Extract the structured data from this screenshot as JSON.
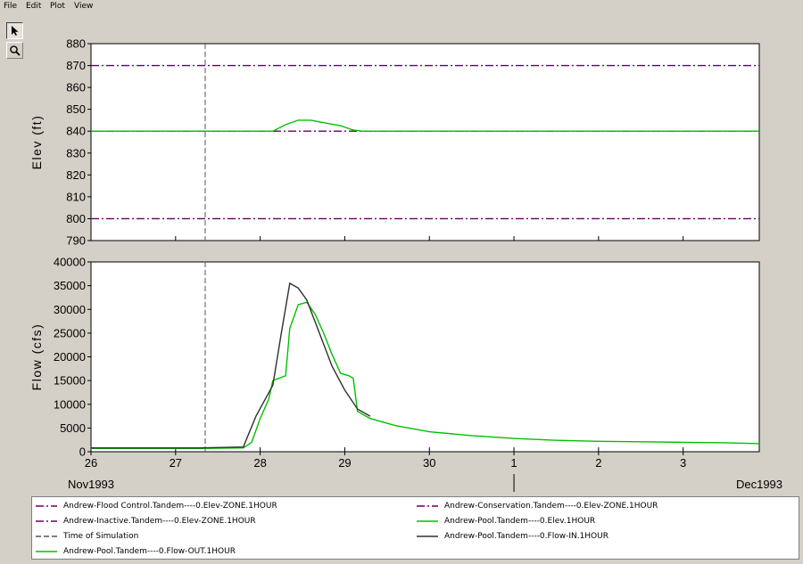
{
  "menu": [
    "File",
    "Edit",
    "Plot",
    "View"
  ],
  "toolbar": {
    "pointer_icon": "arrow-pointer-icon",
    "zoom_icon": "magnifier-icon"
  },
  "colors": {
    "guide": "#660066",
    "pool": "#00c000",
    "inflow": "#303030",
    "sim_time": "#555555"
  },
  "chart_data": [
    {
      "type": "line",
      "ylabel": "Elev (ft)",
      "ylim": [
        790,
        880
      ],
      "yticks": [
        790,
        800,
        810,
        820,
        830,
        840,
        850,
        860,
        870,
        880
      ],
      "xlim": [
        26,
        33.9
      ],
      "grid": false,
      "series": [
        {
          "name": "Andrew-Flood Control.Tandem----0.Elev-ZONE.1HOUR",
          "style": "dashdot",
          "color": "#660066",
          "x": [
            26,
            33.9
          ],
          "y": [
            870,
            870
          ]
        },
        {
          "name": "Andrew-Conservation.Tandem----0.Elev-ZONE.1HOUR",
          "style": "dashdot",
          "color": "#660066",
          "x": [
            26,
            28.2,
            29.0,
            33.9
          ],
          "y": [
            840,
            840,
            840,
            840
          ]
        },
        {
          "name": "Andrew-Inactive.Tandem----0.Elev-ZONE.1HOUR",
          "style": "dashdot",
          "color": "#660066",
          "x": [
            26,
            33.9
          ],
          "y": [
            800,
            800
          ]
        },
        {
          "name": "Andrew-Pool.Tandem----0.Elev.1HOUR",
          "style": "solid",
          "color": "#00c000",
          "x": [
            26,
            28.15,
            28.3,
            28.45,
            28.6,
            28.8,
            28.95,
            29.1,
            29.2,
            33.9
          ],
          "y": [
            840,
            840,
            843,
            845,
            845,
            843.5,
            842.5,
            840.5,
            840,
            840
          ]
        }
      ]
    },
    {
      "type": "line",
      "ylabel": "Flow (cfs)",
      "ylim": [
        0,
        40000
      ],
      "yticks": [
        0,
        5000,
        10000,
        15000,
        20000,
        25000,
        30000,
        35000,
        40000
      ],
      "xlim": [
        26,
        33.9
      ],
      "xticks": [
        {
          "x": 26,
          "label": "26"
        },
        {
          "x": 27,
          "label": "27"
        },
        {
          "x": 28,
          "label": "28"
        },
        {
          "x": 29,
          "label": "29"
        },
        {
          "x": 30,
          "label": "30"
        },
        {
          "x": 31,
          "label": "1"
        },
        {
          "x": 32,
          "label": "2"
        },
        {
          "x": 33,
          "label": "3"
        }
      ],
      "month_labels": [
        {
          "x": 26,
          "label": "Nov1993"
        },
        {
          "x": 33.9,
          "label": "Dec1993"
        }
      ],
      "month_divider_x": 31,
      "time_of_simulation_x": 27.35,
      "grid": false,
      "series": [
        {
          "name": "Andrew-Pool.Tandem----0.Flow-OUT.1HOUR",
          "style": "solid",
          "color": "#00c000",
          "x": [
            26,
            27.3,
            27.8,
            27.9,
            28.0,
            28.1,
            28.15,
            28.3,
            28.35,
            28.45,
            28.55,
            28.65,
            28.75,
            28.85,
            28.95,
            29.05,
            29.1,
            29.15,
            29.3,
            29.6,
            30.0,
            30.5,
            31.0,
            31.5,
            32.0,
            32.5,
            33.0,
            33.5,
            33.9
          ],
          "y": [
            700,
            700,
            800,
            2000,
            7000,
            11000,
            15000,
            16000,
            26000,
            31000,
            31500,
            29000,
            25000,
            20500,
            16500,
            16000,
            15500,
            8500,
            7000,
            5500,
            4200,
            3400,
            2800,
            2400,
            2200,
            2100,
            2000,
            1900,
            1700
          ]
        },
        {
          "name": "Andrew-Pool.Tandem----0.Flow-IN.1HOUR",
          "style": "solid",
          "color": "#303030",
          "x": [
            26,
            27.3,
            27.8,
            27.95,
            28.15,
            28.25,
            28.35,
            28.45,
            28.55,
            28.7,
            28.85,
            29.0,
            29.15,
            29.3
          ],
          "y": [
            800,
            800,
            1000,
            7500,
            14000,
            25000,
            35500,
            34500,
            32000,
            25000,
            18000,
            13000,
            9000,
            7500
          ]
        }
      ]
    }
  ],
  "legend": [
    {
      "label": "Andrew-Flood Control.Tandem----0.Elev-ZONE.1HOUR",
      "style": "dashdot",
      "color": "#660066"
    },
    {
      "label": "Andrew-Conservation.Tandem----0.Elev-ZONE.1HOUR",
      "style": "dashdot",
      "color": "#660066"
    },
    {
      "label": "Andrew-Inactive.Tandem----0.Elev-ZONE.1HOUR",
      "style": "dashdot",
      "color": "#660066"
    },
    {
      "label": "Andrew-Pool.Tandem----0.Elev.1HOUR",
      "style": "solid",
      "color": "#00c000"
    },
    {
      "label": "Time of Simulation",
      "style": "dashed",
      "color": "#555555"
    },
    {
      "label": "Andrew-Pool.Tandem----0.Flow-IN.1HOUR",
      "style": "solid",
      "color": "#303030"
    },
    {
      "label": "Andrew-Pool.Tandem----0.Flow-OUT.1HOUR",
      "style": "solid",
      "color": "#00c000"
    }
  ]
}
